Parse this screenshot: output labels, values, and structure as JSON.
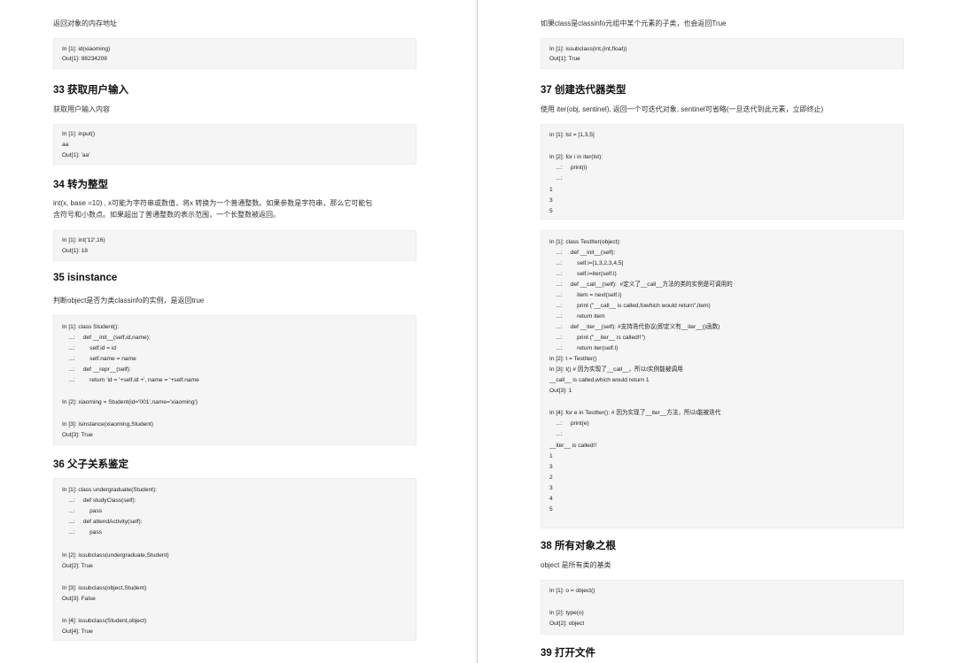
{
  "left": {
    "p_addr": "返回对象的内存地址",
    "c_id": [
      "In [1]: id(xiaoming)",
      "Out[1]: 98234208"
    ],
    "h33": "33 获取用户输入",
    "p33": "获取用户输入内容",
    "c33": [
      "In [1]: input()",
      "aa",
      "Out[1]: 'aa'"
    ],
    "h34": "34 转为整型",
    "p34a": "int(x, base =10) , x可能为字符串或数值，将x 转换为一个普通整数。如果参数是字符串，那么它可能包",
    "p34b": "含符号和小数点。如果超出了普通整数的表示范围，一个长整数被返回。",
    "c34": [
      "In [1]: int('12',16)",
      "Out[1]: 18"
    ],
    "h35": "35 isinstance",
    "p35": "判断object是否为类classinfo的实例，是返回true",
    "c35": [
      "In [1]: class Student():",
      "    ...:     def __init__(self,id,name):",
      "    ...:         self.id = id",
      "    ...:         self.name = name",
      "    ...:     def __repr__(self):",
      "    ...:         return 'id = '+self.id +', name = '+self.name",
      "In [2]: xiaoming = Student(id='001',name='xiaoming')",
      "In [3]: isinstance(xiaoming,Student)",
      "Out[3]: True"
    ],
    "h36": "36 父子关系鉴定",
    "c36": [
      "In [1]: class undergraduate(Student):",
      "    ...:     def studyClass(self):",
      "    ...:         pass",
      "    ...:     def attendActivity(self):",
      "    ...:         pass",
      "In [2]: issubclass(undergraduate,Student)",
      "Out[2]: True",
      "In [3]: issubclass(object,Student)",
      "Out[3]: False",
      "In [4]: issubclass(Student,object)",
      "Out[4]: True"
    ]
  },
  "right": {
    "p_sub": "如果class是classinfo元组中某个元素的子类，也会返回True",
    "c_sub": [
      "In [1]: issubclass(int,(int,float))",
      "Out[1]: True"
    ],
    "h37": "37 创建迭代器类型",
    "p37": "使用 iter(obj, sentinel), 返回一个可迭代对象, sentinel可省略(一旦迭代到此元素，立即终止)",
    "c37a": [
      "In [1]: lst = [1,3,5]",
      "In [2]: for i in iter(lst):",
      "    ...:     print(i)",
      "    ...:",
      "1",
      "3",
      "5"
    ],
    "c37b": [
      "In [1]: class TestIter(object):",
      "    ...:     def __init__(self):",
      "    ...:         self.l=[1,3,2,3,4,5]",
      "    ...:         self.i=iter(self.l)",
      "    ...:     def __call__(self):  #定义了__call__方法的类的实例是可调用的",
      "    ...:         item = next(self.i)",
      "    ...:         print (\"__call__ is called,fowhich would return\",item)",
      "    ...:         return item",
      "    ...:     def __iter__(self): #支持迭代协议(即定义有__iter__()函数)",
      "    ...:         print (\"__iter__ is called!!\")",
      "    ...:         return iter(self.l)",
      "In [2]: t = TestIter()",
      "In [3]: t() # 因为实现了__call__，所以t实例能被调用",
      "__call__ is called,which would return 1",
      "Out[3]: 1",
      "In [4]: for e in TestIter(): # 因为实现了__iter__方法，所以t能被迭代",
      "    ...:     print(e)",
      "    ...:",
      "__iter__ is called!!",
      "1",
      "3",
      "2",
      "3",
      "4",
      "5"
    ],
    "h38": "38 所有对象之根",
    "p38": "object 是所有类的基类",
    "c38": [
      "In [1]: o = object()",
      "In [2]: type(o)",
      "Out[2]: object"
    ],
    "h39": "39 打开文件"
  }
}
